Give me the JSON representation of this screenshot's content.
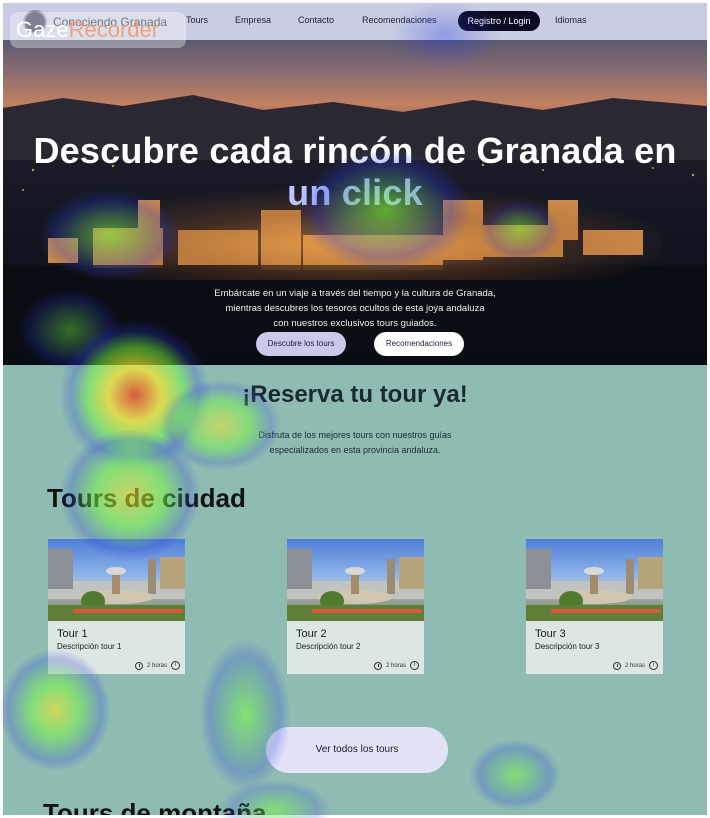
{
  "navbar": {
    "brand": "Conociendo Granada",
    "items": [
      "Tours",
      "Empresa",
      "Contacto",
      "Recomendaciones"
    ],
    "login": "Registro / Login",
    "languages": "Idiomas"
  },
  "hero": {
    "title_line1": "Descubre cada rincón de Granada en",
    "title_line2": "un click",
    "subtitle_line1": "Embárcate en un viaje a través del tiempo y la cultura de Granada,",
    "subtitle_line2": "mientras descubres los tesoros ocultos de esta joya andaluza",
    "subtitle_line3": "con nuestros exclusivos tours guiados.",
    "btn_tours": "Descubre los tours",
    "btn_recs": "Recomendaciones"
  },
  "reserva": {
    "title": "¡Reserva tu tour ya!",
    "text_line1": "Disfruta de los mejores tours con nuestros guías",
    "text_line2": "especializados en esta provincia andaluza."
  },
  "sections": {
    "city_title": "Tours de ciudad",
    "mountain_title": "Tours de montaña"
  },
  "tours": [
    {
      "title": "Tour 1",
      "description": "Descripción tour 1",
      "duration": "2 horas"
    },
    {
      "title": "Tour 2",
      "description": "Descripción tour 2",
      "duration": "2 horas"
    },
    {
      "title": "Tour 3",
      "description": "Descripción tour 3",
      "duration": "2 horas"
    }
  ],
  "btn_all_tours": "Ver todos los tours",
  "watermark": {
    "part1": "Gaze",
    "part2": "Recorder"
  },
  "colors": {
    "navbar_bg": "#c8cde3",
    "page_bg": "#8ebcb3",
    "login_bg": "#0b0c23",
    "hero_accent": "#bcc5ff"
  },
  "icons": [
    "clock-icon",
    "info-icon",
    "brand-logo-icon"
  ]
}
